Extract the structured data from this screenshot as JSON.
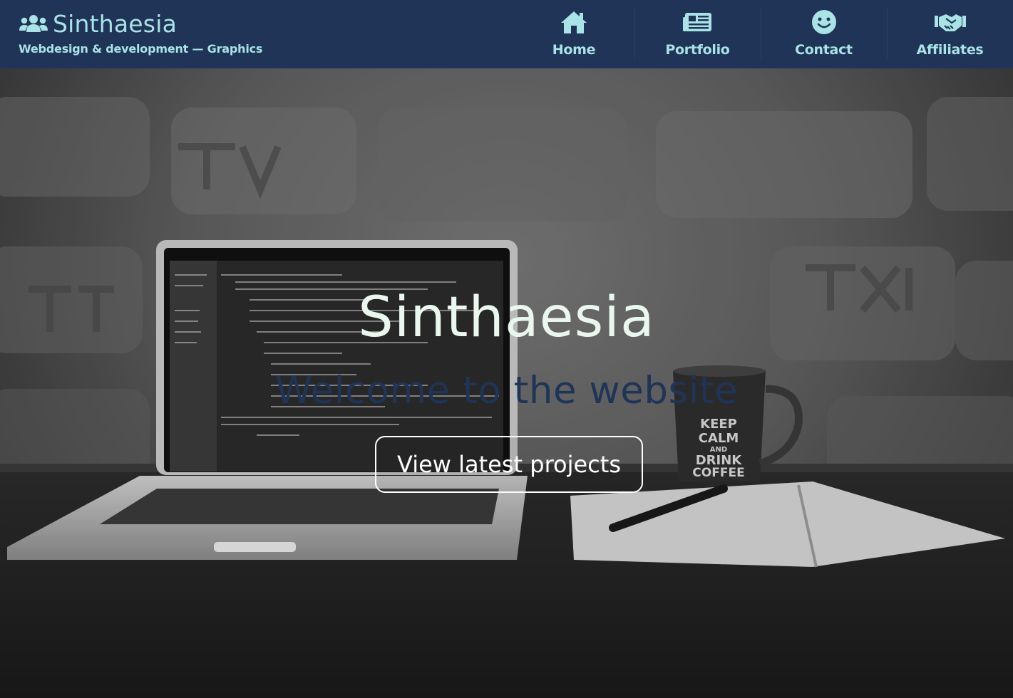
{
  "header": {
    "brand_title": "Sinthaesia",
    "brand_subtitle": "Webdesign & development — Graphics",
    "nav": [
      {
        "label": "Home",
        "icon": "home-icon"
      },
      {
        "label": "Portfolio",
        "icon": "newspaper-icon"
      },
      {
        "label": "Contact",
        "icon": "smile-icon"
      },
      {
        "label": "Affiliates",
        "icon": "handshake-icon"
      }
    ]
  },
  "hero": {
    "title": "Sinthaesia",
    "subtitle": "Welcome to the website",
    "cta_label": "View latest projects",
    "mug_text": [
      "KEEP",
      "CALM",
      "AND",
      "DRINK",
      "COFFEE"
    ]
  },
  "colors": {
    "header_bg": "#1f3457",
    "accent": "#a9e3e6",
    "hero_title": "#eaf7ef",
    "hero_subtitle": "#1f3457"
  }
}
